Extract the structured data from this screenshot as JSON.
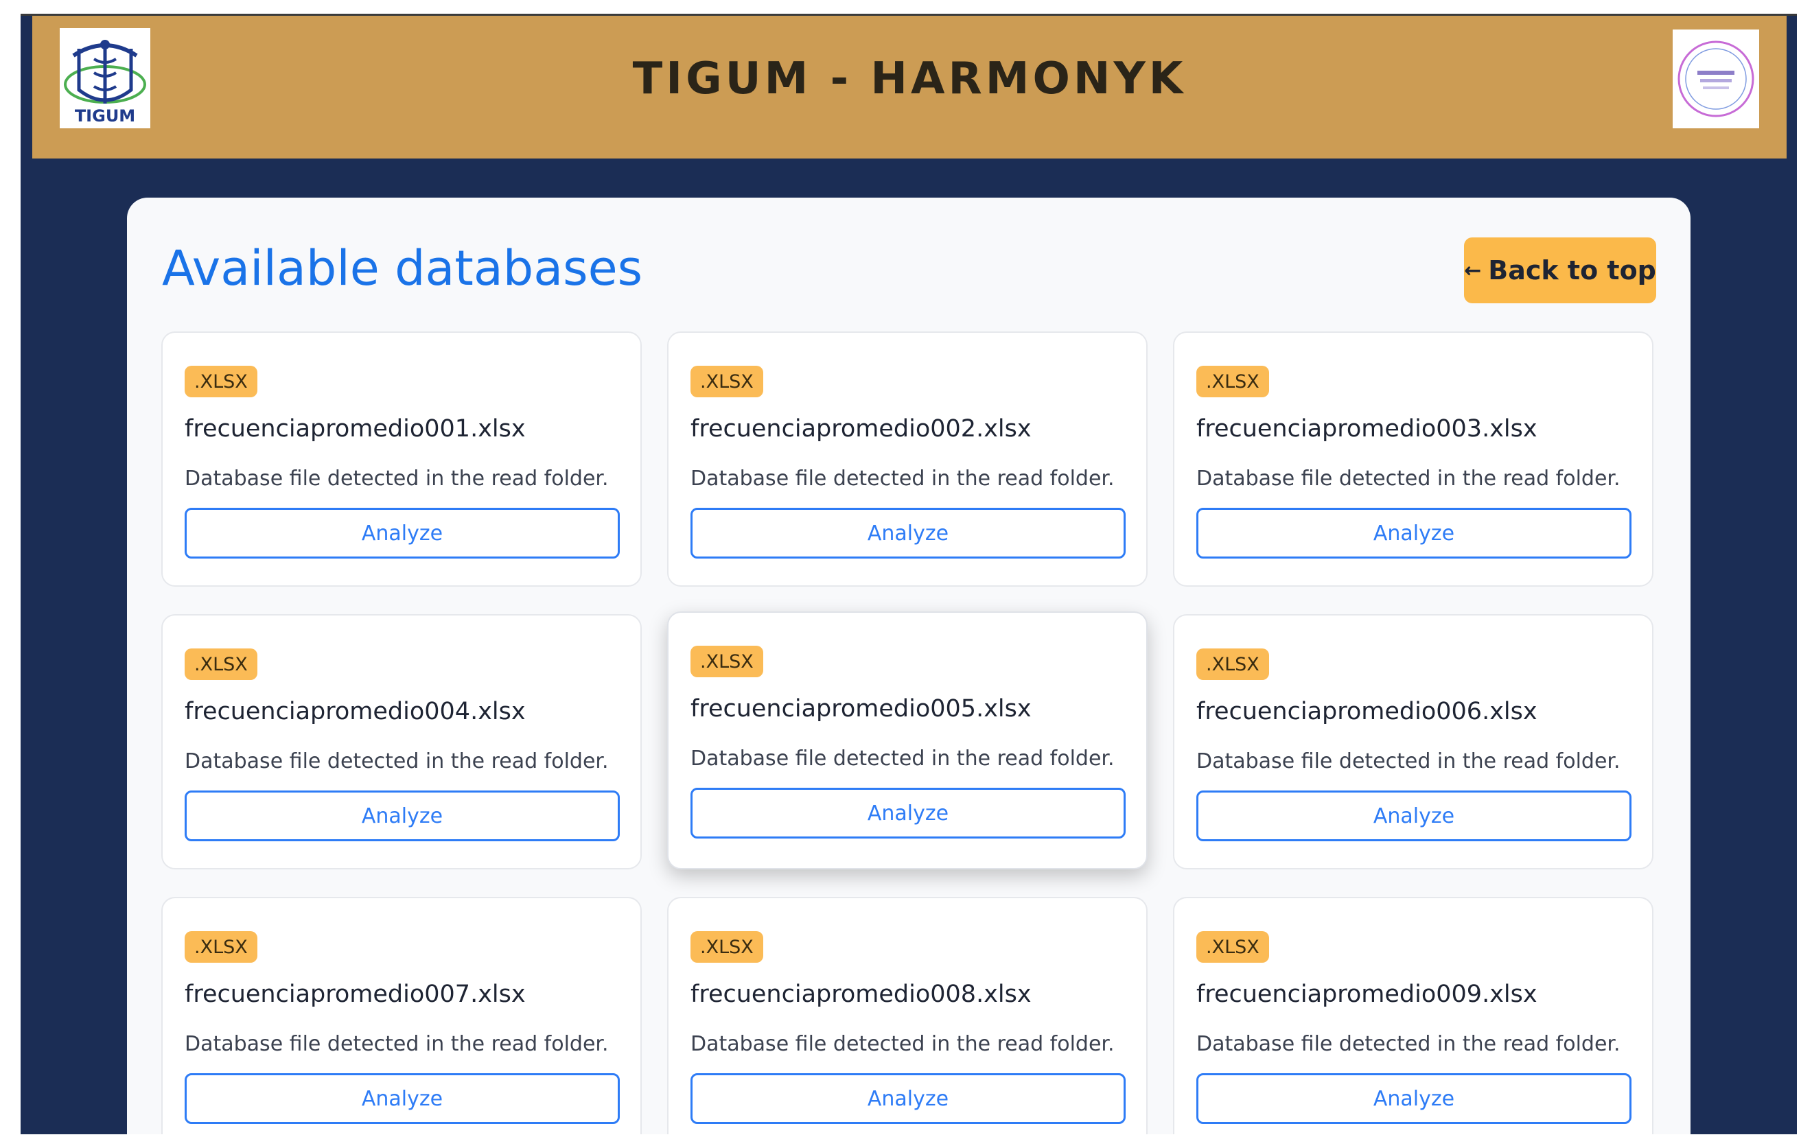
{
  "header": {
    "title": "TIGUM - HARMONYK",
    "logo_left_text": "TIGUM",
    "logo_left_icon": "caduceus-icon",
    "logo_right_icon": "seal-icon"
  },
  "main": {
    "title": "Available databases",
    "back_button": {
      "arrow": "←",
      "label": "Back to top"
    },
    "cards": [
      {
        "badge": ".XLSX",
        "name": "frecuenciapromedio001.xlsx",
        "description": "Database file detected in the read folder.",
        "action": "Analyze"
      },
      {
        "badge": ".XLSX",
        "name": "frecuenciapromedio002.xlsx",
        "description": "Database file detected in the read folder.",
        "action": "Analyze"
      },
      {
        "badge": ".XLSX",
        "name": "frecuenciapromedio003.xlsx",
        "description": "Database file detected in the read folder.",
        "action": "Analyze"
      },
      {
        "badge": ".XLSX",
        "name": "frecuenciapromedio004.xlsx",
        "description": "Database file detected in the read folder.",
        "action": "Analyze"
      },
      {
        "badge": ".XLSX",
        "name": "frecuenciapromedio005.xlsx",
        "description": "Database file detected in the read folder.",
        "action": "Analyze"
      },
      {
        "badge": ".XLSX",
        "name": "frecuenciapromedio006.xlsx",
        "description": "Database file detected in the read folder.",
        "action": "Analyze"
      },
      {
        "badge": ".XLSX",
        "name": "frecuenciapromedio007.xlsx",
        "description": "Database file detected in the read folder.",
        "action": "Analyze"
      },
      {
        "badge": ".XLSX",
        "name": "frecuenciapromedio008.xlsx",
        "description": "Database file detected in the read folder.",
        "action": "Analyze"
      },
      {
        "badge": ".XLSX",
        "name": "frecuenciapromedio009.xlsx",
        "description": "Database file detected in the read folder.",
        "action": "Analyze"
      }
    ]
  },
  "colors": {
    "header_bg": "#cc9c54",
    "page_bg": "#1b2d55",
    "accent_blue": "#1a73e8",
    "badge_bg": "#fbbb56",
    "back_button_bg": "#fbb94a"
  }
}
